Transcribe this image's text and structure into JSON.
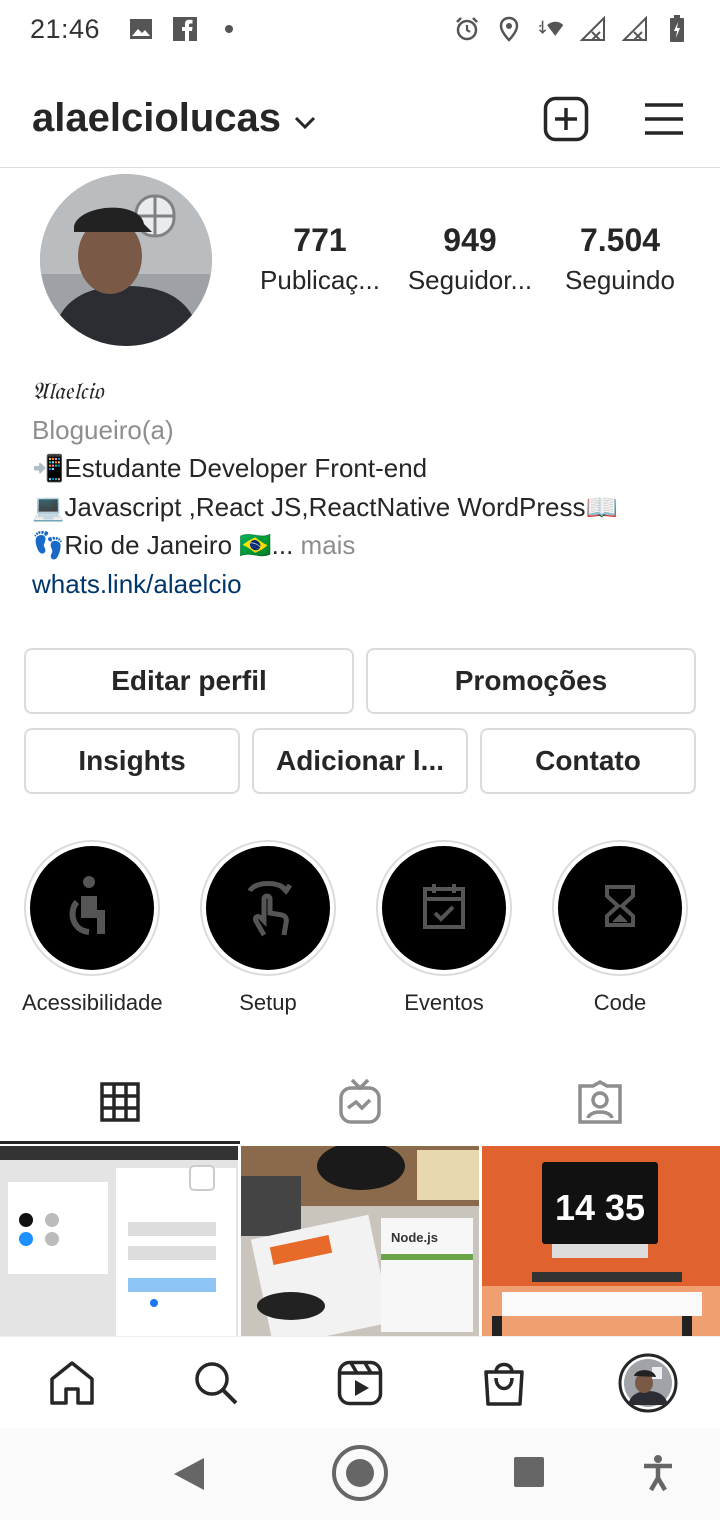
{
  "status_bar": {
    "time": "21:46",
    "left_icons": [
      "gallery-icon",
      "facebook-icon",
      "dot-icon"
    ],
    "right_icons": [
      "alarm-icon",
      "location-icon",
      "wifi-icon",
      "signal-icon",
      "signal-icon",
      "battery-icon"
    ]
  },
  "header": {
    "username": "alaelciolucas"
  },
  "profile": {
    "stats": [
      {
        "value": "771",
        "label": "Publicaç..."
      },
      {
        "value": "949",
        "label": "Seguidor..."
      },
      {
        "value": "7.504",
        "label": "Seguindo"
      }
    ],
    "bio": {
      "name": "𝔄𝔩𝔞𝔢𝔩𝔠𝔦𝔬",
      "category": "Blogueiro(a)",
      "line1": "📲Estudante Developer Front-end",
      "line2": "💻Javascript ,React JS,ReactNative WordPress📖",
      "line3": "👣Rio de Janeiro 🇧🇷...",
      "more": "mais",
      "link": "whats.link/alaelcio"
    }
  },
  "buttons": {
    "edit_profile": "Editar perfil",
    "promotions": "Promoções",
    "insights": "Insights",
    "add": "Adicionar l...",
    "contact": "Contato"
  },
  "highlights": [
    {
      "label": "Acessibilidade",
      "icon": "accessibility-icon"
    },
    {
      "label": "Setup",
      "icon": "touch-icon"
    },
    {
      "label": "Eventos",
      "icon": "calendar-icon"
    },
    {
      "label": "Code",
      "icon": "hourglass-icon"
    }
  ],
  "grid": {
    "post2_label": "Node.js",
    "post3_clock": "14 35"
  },
  "colors": {
    "link": "#00376b",
    "muted": "#8e8e8e",
    "border": "#dbdbdb",
    "text": "#262626"
  }
}
